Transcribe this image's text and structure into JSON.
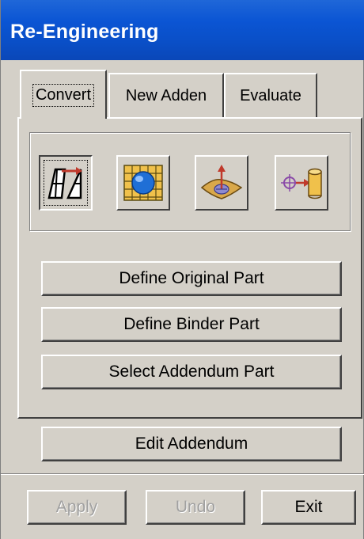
{
  "window": {
    "title": "Re-Engineering"
  },
  "tabs": [
    {
      "label": "Convert",
      "active": true
    },
    {
      "label": "New Adden",
      "active": false
    },
    {
      "label": "Evaluate",
      "active": false
    }
  ],
  "toolbar": {
    "icons": [
      "quad-mesh-transform-icon",
      "surface-grid-sphere-icon",
      "surface-normal-icon",
      "point-to-cylinder-icon"
    ]
  },
  "buttons": {
    "define_original": "Define Original Part",
    "define_binder": "Define Binder Part",
    "select_addendum": "Select Addendum Part",
    "edit_addendum": "Edit Addendum"
  },
  "footer": {
    "apply": "Apply",
    "undo": "Undo",
    "exit": "Exit"
  }
}
